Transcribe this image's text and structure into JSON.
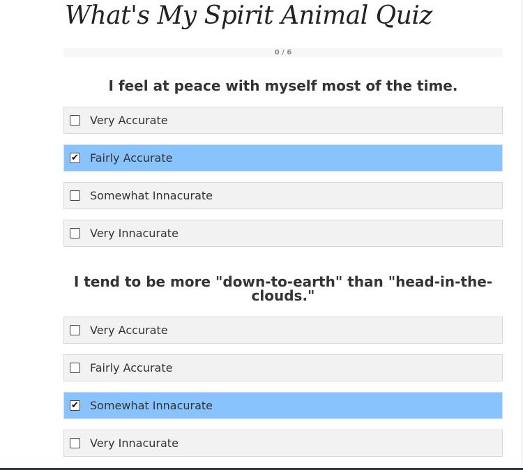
{
  "title": "What's My Spirit Animal Quiz",
  "progress": {
    "text": "0 / 6",
    "answered": 0,
    "total": 6
  },
  "questions": [
    {
      "text": "I feel at peace with myself most of the time.",
      "options": [
        {
          "label": "Very Accurate",
          "checked": false
        },
        {
          "label": "Fairly Accurate",
          "checked": true
        },
        {
          "label": "Somewhat Innacurate",
          "checked": false
        },
        {
          "label": "Very Innacurate",
          "checked": false
        }
      ]
    },
    {
      "text": "I tend to be more \"down-to-earth\" than \"head-in-the-clouds.\"",
      "options": [
        {
          "label": "Very Accurate",
          "checked": false
        },
        {
          "label": "Fairly Accurate",
          "checked": false
        },
        {
          "label": "Somewhat Innacurate",
          "checked": true
        },
        {
          "label": "Very Innacurate",
          "checked": false
        }
      ]
    }
  ],
  "colors": {
    "selected": "#89c3fd",
    "option_bg": "#f2f2f2"
  }
}
